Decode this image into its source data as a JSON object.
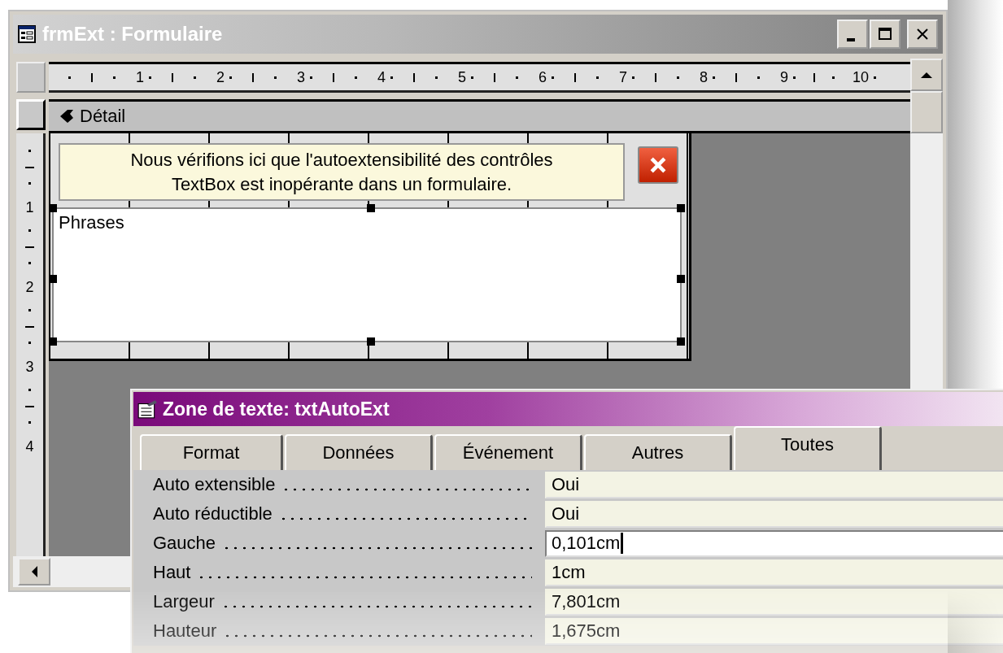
{
  "window": {
    "title": "frmExt : Formulaire"
  },
  "ruler": {
    "top_numbers": [
      "1",
      "2",
      "3",
      "4",
      "5",
      "6",
      "7",
      "8",
      "9",
      "10"
    ],
    "left_numbers": [
      "1",
      "2",
      "3",
      "4"
    ]
  },
  "section": {
    "title": "Détail"
  },
  "form": {
    "label": "Nous vérifions ici que l'autoextensibilité des contrôles TextBox est inopérante dans un formulaire.",
    "textbox": {
      "value": "Phrases",
      "selected": true
    }
  },
  "property_sheet": {
    "title": "Zone de texte: txtAutoExt",
    "tabs": [
      {
        "label": "Format",
        "selected": false
      },
      {
        "label": "Données",
        "selected": false
      },
      {
        "label": "Événement",
        "selected": false
      },
      {
        "label": "Autres",
        "selected": false
      },
      {
        "label": "Toutes",
        "selected": true
      }
    ],
    "rows": [
      {
        "label": "Auto extensible",
        "value": "Oui",
        "focused": false
      },
      {
        "label": "Auto réductible",
        "value": "Oui",
        "focused": false
      },
      {
        "label": "Gauche",
        "value": "0,101cm",
        "focused": true
      },
      {
        "label": "Haut",
        "value": "1cm",
        "focused": false
      },
      {
        "label": "Largeur",
        "value": "7,801cm",
        "focused": false
      },
      {
        "label": "Hauteur",
        "value": "1,675cm",
        "focused": false
      }
    ]
  }
}
